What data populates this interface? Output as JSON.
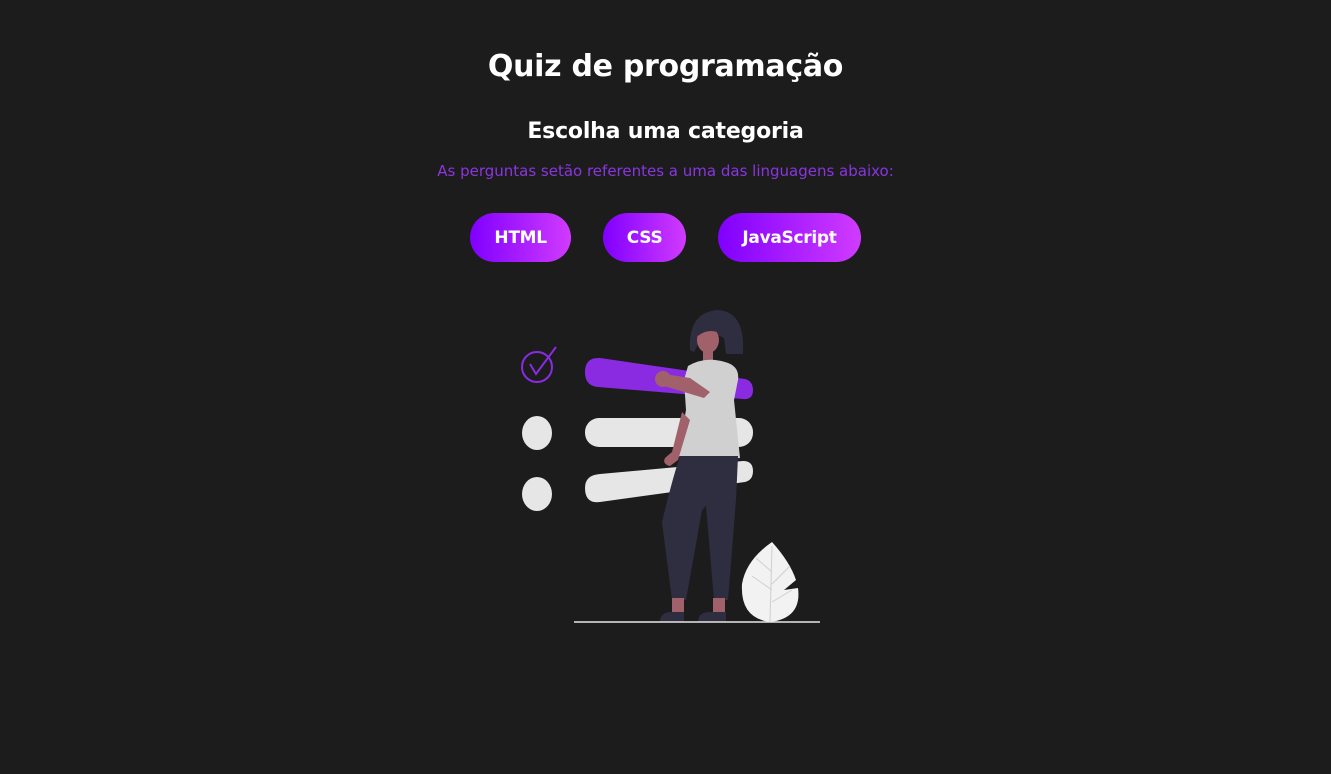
{
  "header": {
    "title": "Quiz de programação",
    "subtitle": "Escolha uma categoria",
    "description": "As perguntas setão referentes a uma das linguagens abaixo:"
  },
  "categories": [
    {
      "label": "HTML"
    },
    {
      "label": "CSS"
    },
    {
      "label": "JavaScript"
    }
  ],
  "illustration": {
    "icon": "quiz-checklist-illustration"
  },
  "colors": {
    "background": "#1c1c1c",
    "accent": "#8a2be2",
    "description_text": "#8a35e0",
    "button_gradient_start": "#8000ff",
    "button_gradient_end": "#d13bff",
    "text": "#ffffff"
  }
}
